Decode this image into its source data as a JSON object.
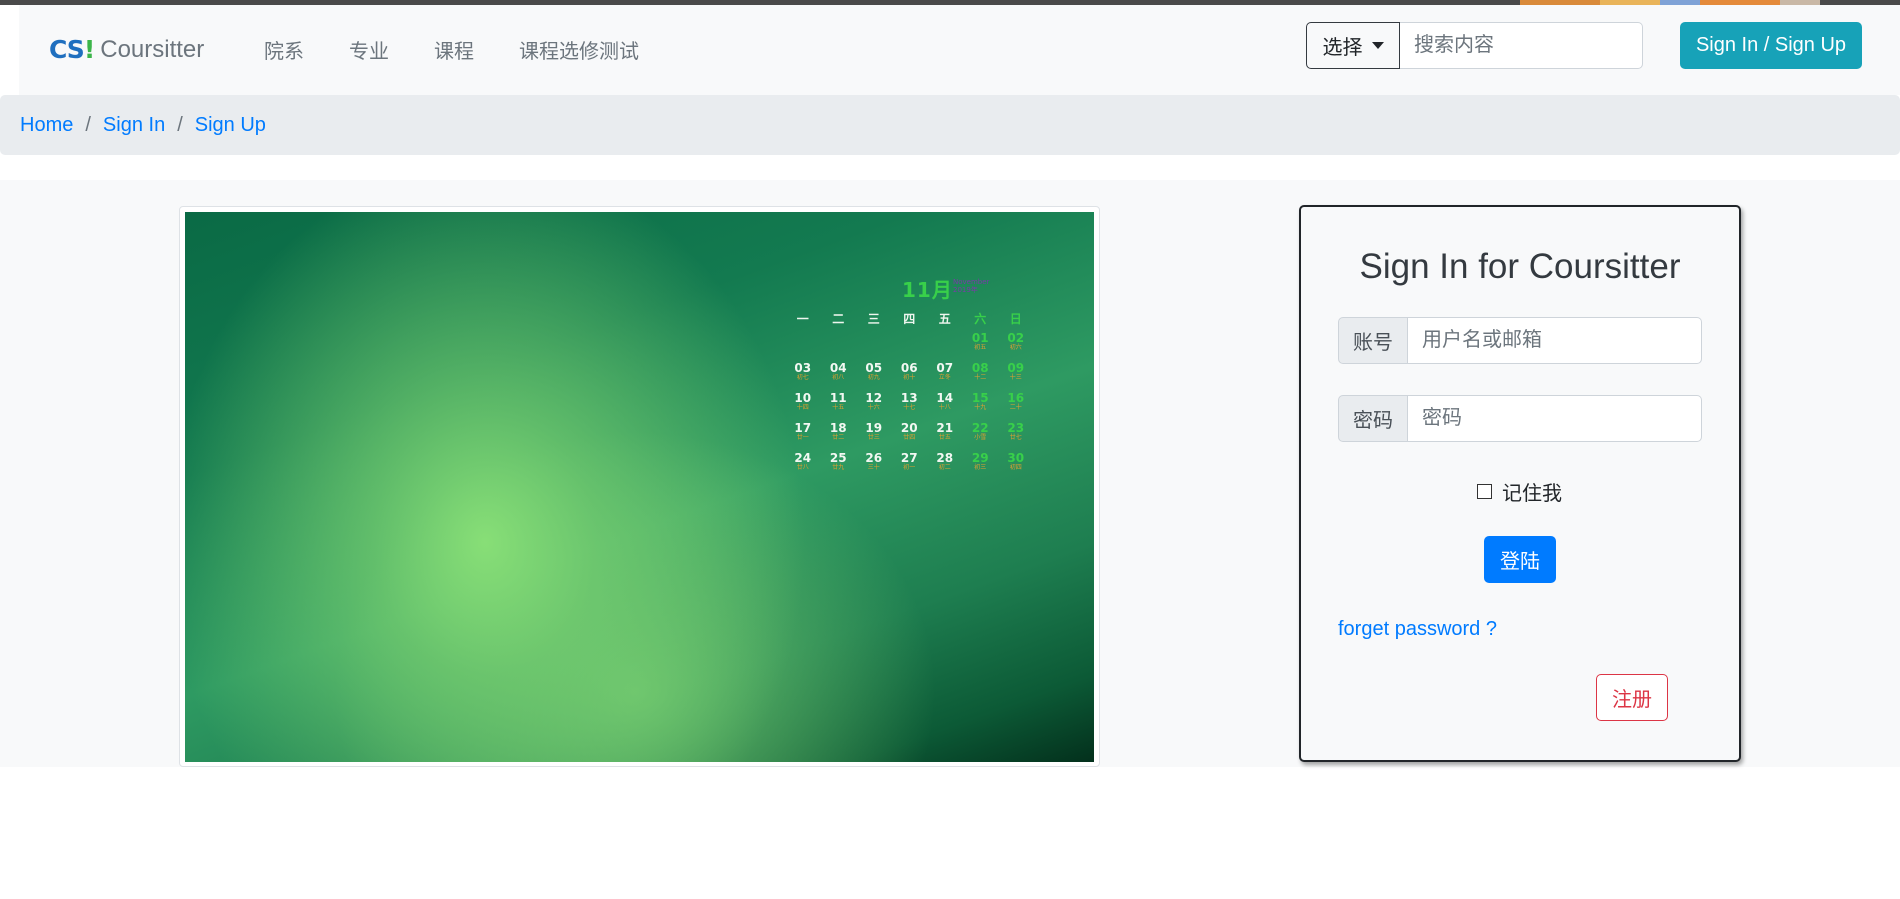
{
  "navbar": {
    "brand_logo": "CS",
    "brand_logo_mark": "!",
    "brand_name": "Coursitter",
    "links": [
      "院系",
      "专业",
      "课程",
      "课程选修测试"
    ],
    "select_label": "选择",
    "search_placeholder": "搜索内容",
    "signin_label": "Sign In / Sign Up"
  },
  "breadcrumb": {
    "items": [
      "Home",
      "Sign In",
      "Sign Up"
    ],
    "separator": "/"
  },
  "wallpaper": {
    "calendar": {
      "month": "11月",
      "month_sub": [
        "November",
        "2019年"
      ],
      "weekdays": [
        "一",
        "二",
        "三",
        "四",
        "五",
        "六",
        "日"
      ],
      "weeks": [
        [
          null,
          null,
          null,
          null,
          null,
          {
            "d": "01",
            "l": "初五"
          },
          {
            "d": "02",
            "l": "初六"
          }
        ],
        [
          {
            "d": "03",
            "l": "初七"
          },
          {
            "d": "04",
            "l": "初八"
          },
          {
            "d": "05",
            "l": "初九"
          },
          {
            "d": "06",
            "l": "初十"
          },
          {
            "d": "07",
            "l": "立冬"
          },
          {
            "d": "08",
            "l": "十二"
          },
          {
            "d": "09",
            "l": "十三"
          }
        ],
        [
          {
            "d": "10",
            "l": "十四"
          },
          {
            "d": "11",
            "l": "十五"
          },
          {
            "d": "12",
            "l": "十六"
          },
          {
            "d": "13",
            "l": "十七"
          },
          {
            "d": "14",
            "l": "十八"
          },
          {
            "d": "15",
            "l": "十九"
          },
          {
            "d": "16",
            "l": "二十"
          }
        ],
        [
          {
            "d": "17",
            "l": "廿一"
          },
          {
            "d": "18",
            "l": "廿二"
          },
          {
            "d": "19",
            "l": "廿三"
          },
          {
            "d": "20",
            "l": "廿四"
          },
          {
            "d": "21",
            "l": "廿五"
          },
          {
            "d": "22",
            "l": "小雪"
          },
          {
            "d": "23",
            "l": "廿七"
          }
        ],
        [
          {
            "d": "24",
            "l": "廿八"
          },
          {
            "d": "25",
            "l": "廿九"
          },
          {
            "d": "26",
            "l": "三十"
          },
          {
            "d": "27",
            "l": "初一"
          },
          {
            "d": "28",
            "l": "初二"
          },
          {
            "d": "29",
            "l": "初三"
          },
          {
            "d": "30",
            "l": "初四"
          }
        ]
      ]
    }
  },
  "login": {
    "title": "Sign In for Coursitter",
    "account_label": "账号",
    "account_placeholder": "用户名或邮箱",
    "password_label": "密码",
    "password_placeholder": "密码",
    "remember_label": "记住我",
    "login_button": "登陆",
    "forget_link": "forget password ?",
    "register_button": "注册"
  },
  "colors": {
    "navbar_bg": "#f8f9fa",
    "breadcrumb_bg": "#e9ecef",
    "link": "#007bff",
    "info_button": "#17a2b8",
    "primary_button": "#007bff",
    "danger_outline": "#dc3545",
    "calendar_green": "#38d04a"
  }
}
